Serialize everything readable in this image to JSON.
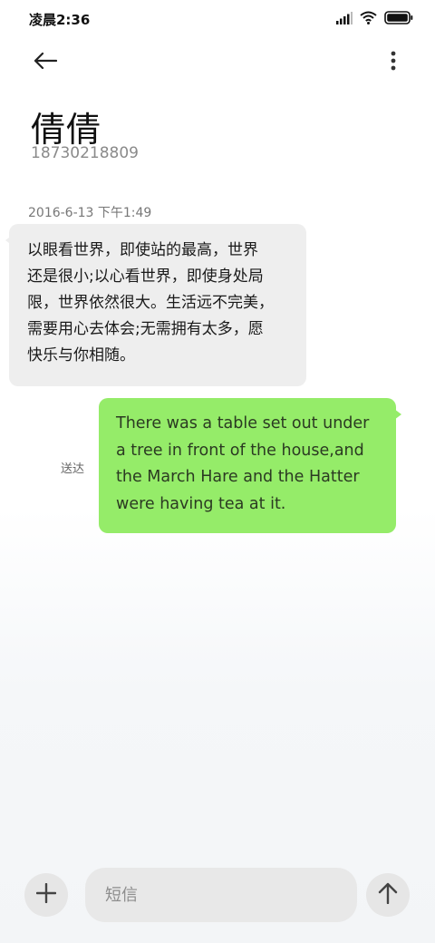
{
  "status_bar": {
    "time": "凌晨2:36",
    "icons": [
      "signal-icon",
      "wifi-icon",
      "battery-icon"
    ]
  },
  "header": {
    "back_icon": "arrow-left-icon",
    "more_icon": "more-vertical-icon",
    "contact_name": "倩倩",
    "contact_number": "18730218809"
  },
  "conversation": {
    "timestamp": "2016-6-13 下午1:49",
    "received_lines": [
      "以眼看世界，即使站的最高，世界",
      "还是很小;以心看世界，即使身处局",
      "限，世界依然很大。生活远不完美，",
      "需要用心去体会;无需拥有太多，愿",
      "快乐与你相随。"
    ],
    "sent_lines": [
      "There was a table set out under",
      "a tree in front of the house,and",
      "the March Hare and the Hatter",
      "were having tea at it."
    ],
    "delivery_status": "送达"
  },
  "composer": {
    "add_icon": "plus-icon",
    "placeholder": "短信",
    "value": "",
    "send_icon": "arrow-up-icon"
  },
  "colors": {
    "received_bubble": "#eeeeee",
    "sent_bubble": "#95ec69"
  }
}
